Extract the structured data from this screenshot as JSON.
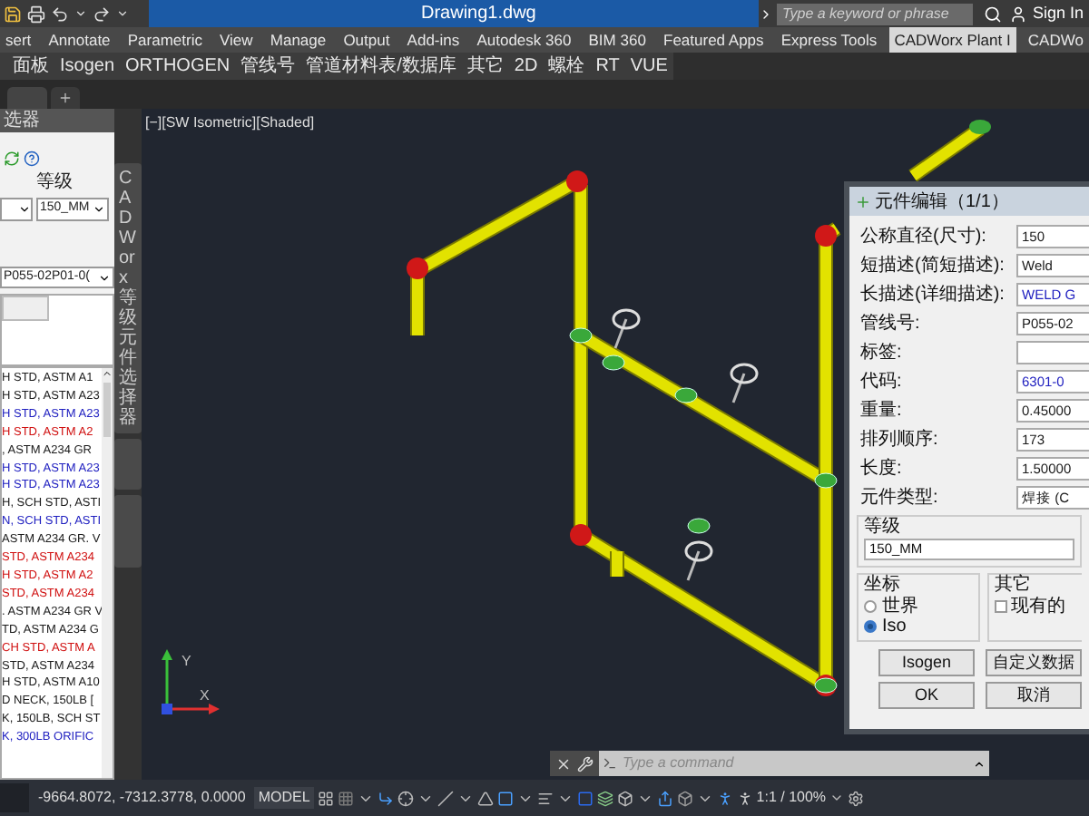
{
  "title_bar": {
    "title": "Drawing1.dwg",
    "search": {
      "placeholder": "Type a keyword or phrase"
    },
    "sign_in": "Sign In"
  },
  "ribbon_tabs": [
    {
      "label": "sert",
      "selected": false
    },
    {
      "label": "Annotate",
      "selected": false
    },
    {
      "label": "Parametric",
      "selected": false
    },
    {
      "label": "View",
      "selected": false
    },
    {
      "label": "Manage",
      "selected": false
    },
    {
      "label": "Output",
      "selected": false
    },
    {
      "label": "Add-ins",
      "selected": false
    },
    {
      "label": "Autodesk 360",
      "selected": false
    },
    {
      "label": "BIM 360",
      "selected": false
    },
    {
      "label": "Featured Apps",
      "selected": false
    },
    {
      "label": "Express Tools",
      "selected": false
    },
    {
      "label": "CADWorx Plant I",
      "selected": true
    },
    {
      "label": "CADWo",
      "selected": false
    }
  ],
  "panel_bar": [
    "面板",
    "Isogen",
    "ORTHOGEN",
    "管线号",
    "管道材料表/数据库",
    "其它",
    "2D",
    "螺栓",
    "RT",
    "VUE"
  ],
  "left_panel": {
    "title": "选器",
    "grade_label": "等级",
    "grade_value": "150_MM",
    "line_value": "P055-02P01-0(",
    "items": [
      {
        "text": "H STD, ASTM A1",
        "color": "#1a1a1a"
      },
      {
        "text": "H STD, ASTM A23",
        "color": "#1a1a1a"
      },
      {
        "text": "H STD, ASTM A23",
        "color": "#2020c0"
      },
      {
        "text": "H STD, ASTM A2",
        "color": "#d01010"
      },
      {
        "text": ", ASTM A234 GR",
        "color": "#1a1a1a"
      },
      {
        "text": "H STD, ASTM A23",
        "color": "#2020c0"
      },
      {
        "text": "H STD, ASTM A23",
        "color": "#2020c0"
      },
      {
        "text": "H, SCH STD, ASTI",
        "color": "#1a1a1a"
      },
      {
        "text": "N, SCH STD, ASTI",
        "color": "#2020c0"
      },
      {
        "text": "ASTM A234 GR. V",
        "color": "#1a1a1a"
      },
      {
        "text": "STD, ASTM A234",
        "color": "#d01010"
      },
      {
        "text": "H STD, ASTM A2",
        "color": "#d01010"
      },
      {
        "text": "STD, ASTM A234",
        "color": "#d01010"
      },
      {
        "text": ". ASTM A234 GR V",
        "color": "#1a1a1a"
      },
      {
        "text": "TD, ASTM A234 G",
        "color": "#1a1a1a"
      },
      {
        "text": "CH STD, ASTM A",
        "color": "#d01010"
      },
      {
        "text": "STD, ASTM A234",
        "color": "#1a1a1a"
      },
      {
        "text": "H STD, ASTM A10",
        "color": "#1a1a1a"
      },
      {
        "text": "D NECK, 150LB [",
        "color": "#1a1a1a"
      },
      {
        "text": "K, 150LB, SCH ST",
        "color": "#1a1a1a"
      },
      {
        "text": "K, 300LB ORIFIC",
        "color": "#2020c0"
      }
    ]
  },
  "side_tab": "CADWorx 等级元件选择器",
  "viewport": {
    "label": "[−][SW Isometric][Shaded]",
    "ucs": {
      "x_label": "X",
      "y_label": "Y"
    }
  },
  "dialog": {
    "title": "元件编辑（1/1）",
    "fields": [
      {
        "label": "公称直径(尺寸):",
        "value": "150",
        "color": "#1a1a1a"
      },
      {
        "label": "短描述(简短描述):",
        "value": "Weld",
        "color": "#1a1a1a"
      },
      {
        "label": "长描述(详细描述):",
        "value": "WELD G",
        "color": "#2020c0"
      },
      {
        "label": "管线号:",
        "value": "P055-02",
        "color": "#1a1a1a"
      },
      {
        "label": "标签:"
      },
      {
        "label": "代码:",
        "value": "6301-0",
        "color": "#2020c0"
      },
      {
        "label": "重量:",
        "value": "0.45000",
        "color": "#1a1a1a"
      },
      {
        "label": "排列顺序:",
        "value": "173",
        "color": "#1a1a1a"
      },
      {
        "label": "长度:",
        "value": "1.50000",
        "color": "#1a1a1a"
      },
      {
        "label": "元件类型:",
        "value": "焊接 (C",
        "color": "#1a1a1a"
      }
    ],
    "grade": {
      "label": "等级",
      "value": "150_MM"
    },
    "coords": {
      "label": "坐标",
      "options": [
        {
          "label": "世界",
          "selected": false
        },
        {
          "label": "Iso",
          "selected": true
        }
      ]
    },
    "other": {
      "label": "其它",
      "checkbox": {
        "label": "现有的",
        "checked": false
      }
    },
    "buttons": [
      "Isogen",
      "自定义数据",
      "OK",
      "取消"
    ]
  },
  "command_line": {
    "placeholder": "Type a command"
  },
  "status_bar": {
    "coordinates": "-9664.8072, -7312.3778, 0.0000",
    "model": "MODEL",
    "scale": "1:1 / 100%"
  }
}
